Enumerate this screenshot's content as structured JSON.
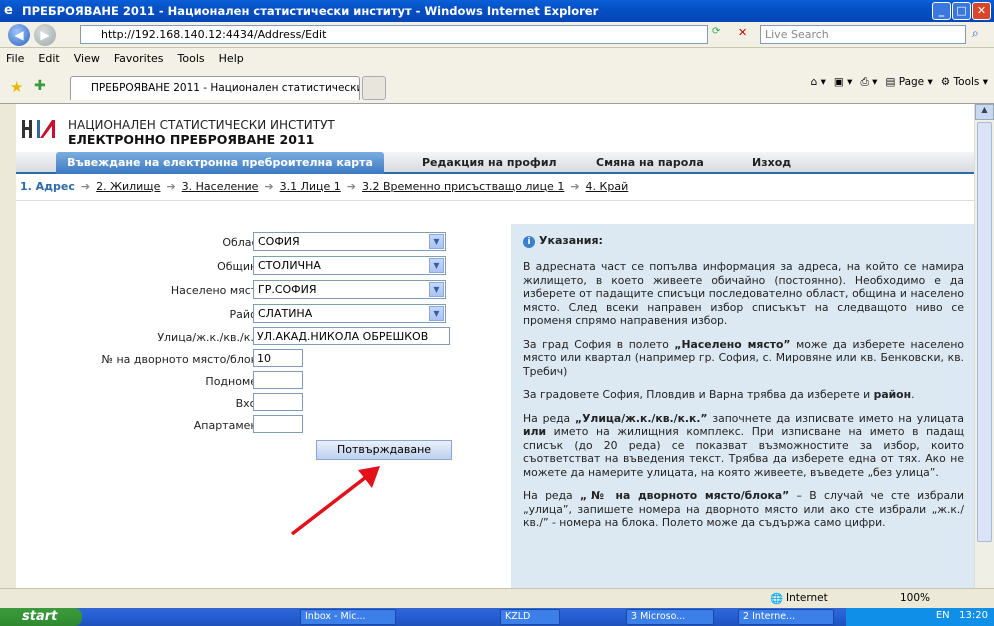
{
  "window": {
    "title": "ПРЕБРОЯВАНЕ 2011 - Национален статистически институт - Windows Internet Explorer"
  },
  "toolbar": {
    "address": "http://192.168.140.12:4434/Address/Edit",
    "search_placeholder": "Live Search"
  },
  "menu": [
    "File",
    "Edit",
    "View",
    "Favorites",
    "Tools",
    "Help"
  ],
  "tab": {
    "label": "ПРЕБРОЯВАНЕ 2011 - Национален статистически и..."
  },
  "ie_tools": {
    "page": "Page",
    "tools": "Tools"
  },
  "header": {
    "org_line1": "НАЦИОНАЛЕН СТАТИСТИЧЕСКИ ИНСТИТУТ",
    "org_line2": "ЕЛЕКТРОННО ПРЕБРОЯВАНЕ 2011"
  },
  "nav": {
    "active": "Въвеждане на електронна преброителна карта",
    "edit_profile": "Редакция на профил",
    "change_password": "Смяна на парола",
    "exit": "Изход"
  },
  "steps": {
    "s1": "1. Адрес",
    "s2": "2. Жилище",
    "s3": "3. Население",
    "s4": "3.1 Лице 1",
    "s5": "3.2 Временно присъстващо лице 1",
    "s6": "4. Край"
  },
  "form": {
    "oblast_label": "Област",
    "oblast_value": "СОФИЯ",
    "obshtina_label": "Община",
    "obshtina_value": "СТОЛИЧНА",
    "naseleno_label": "Населено място",
    "naseleno_value": "ГР.СОФИЯ",
    "rayon_label": "Район",
    "rayon_value": "СЛАТИНА",
    "street_label": "Улица/ж.к./кв./к.к.",
    "street_value": "УЛ.АКАД.НИКОЛА ОБРЕШКОВ",
    "number_label": "№ на дворното място/блока",
    "number_value": "10",
    "subnumber_label": "Подномер",
    "entrance_label": "Вход",
    "apartment_label": "Апартамент",
    "confirm_label": "Потвърждаване"
  },
  "info": {
    "heading": "Указания:",
    "p1": "В адресната част се попълва информация за адреса, на който се намира жилището, в което живеете обичайно (постоянно). Необходимо е да изберете от падащите списъци последователно област, община и населено място. След всеки направен избор списъкът на следващото ниво се променя спрямо направения избор.",
    "p2a": "За град София в полето ",
    "p2b": "„Населено място”",
    "p2c": " може да изберете населено място или квартал (например гр. София, с. Мировяне или кв. Бенковски, кв. Требич)",
    "p3a": "За градовете София, Пловдив и Варна трябва да изберете и ",
    "p3b": "район",
    "p4a": "На реда ",
    "p4b": "„Улица/ж.к./кв./к.к.”",
    "p4c": " започнете да изписвате името на улицата ",
    "p4d": "или",
    "p4e": " името на жилищния комплекс. При изписване на името в падащ списък (до 20 реда) се показват възможностите за избор, които съответстват на въведения текст. Трябва да изберете една от тях. Ако не можете да намерите улицата, на която живеете, въведете „без улица”.",
    "p5a": "На реда ",
    "p5b": "„№ на дворното място/блока”",
    "p5c": " – В случай че сте избрали „улица”, запишете номера на дворното място или ако сте избрали „ж.к./кв./” - номера на блока. Полето може да съдържа само цифри."
  },
  "status": {
    "zone": "Internet",
    "zoom": "100%"
  },
  "taskbar": {
    "start": "start",
    "items": [
      "Inbox - Mic...",
      "KZLD",
      "3 Microso...",
      "2 Interne..."
    ],
    "lang": "EN",
    "clock": "13:20"
  }
}
